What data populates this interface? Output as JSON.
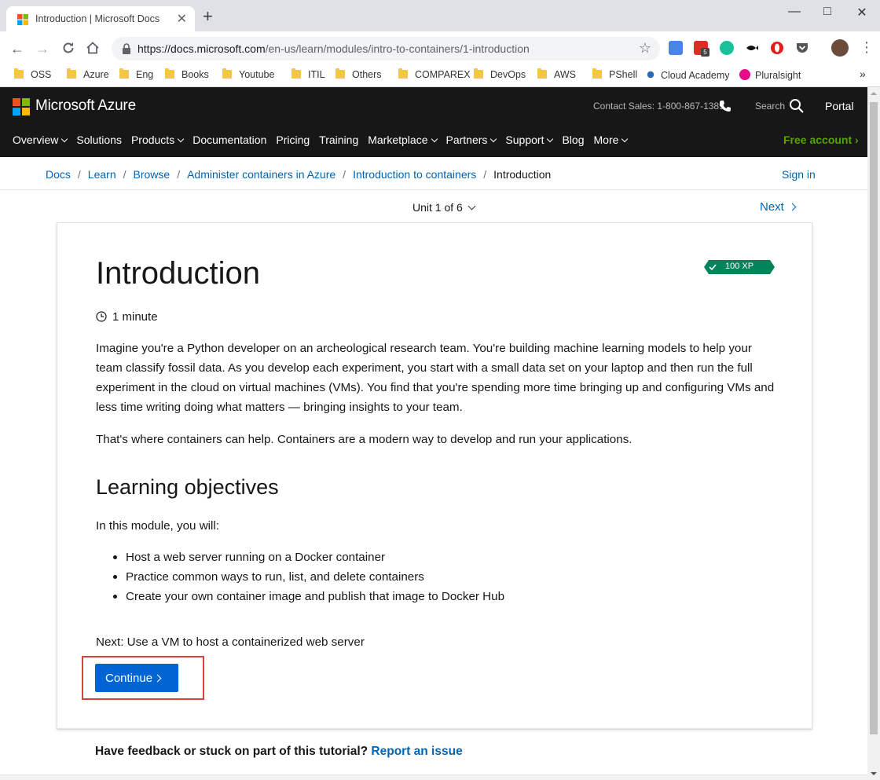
{
  "browser": {
    "tab_title": "Introduction | Microsoft Docs",
    "url_host": "https://docs.microsoft.com",
    "url_path": "/en-us/learn/modules/intro-to-containers/1-introduction",
    "extension_badge": "5",
    "bookmarks": [
      "OSS",
      "Azure",
      "Eng",
      "Books",
      "Youtube",
      "ITIL",
      "Others",
      "COMPAREX",
      "DevOps",
      "AWS",
      "PShell",
      "Cloud Academy",
      "Pluralsight"
    ],
    "bookmarks_more": "»"
  },
  "header": {
    "brand": "Microsoft Azure",
    "contact": "Contact Sales: 1-800-867-1389",
    "search_label": "Search",
    "portal": "Portal",
    "nav": [
      {
        "label": "Overview",
        "dropdown": true
      },
      {
        "label": "Solutions",
        "dropdown": false
      },
      {
        "label": "Products",
        "dropdown": true
      },
      {
        "label": "Documentation",
        "dropdown": false
      },
      {
        "label": "Pricing",
        "dropdown": false
      },
      {
        "label": "Training",
        "dropdown": false
      },
      {
        "label": "Marketplace",
        "dropdown": true
      },
      {
        "label": "Partners",
        "dropdown": true
      },
      {
        "label": "Support",
        "dropdown": true
      },
      {
        "label": "Blog",
        "dropdown": false
      },
      {
        "label": "More",
        "dropdown": true
      }
    ],
    "free_account": "Free account"
  },
  "breadcrumb": {
    "items": [
      "Docs",
      "Learn",
      "Browse",
      "Administer containers in Azure",
      "Introduction to containers"
    ],
    "current": "Introduction",
    "sign_in": "Sign in"
  },
  "unit_nav": {
    "unit_label": "Unit 1 of 6",
    "next_label": "Next"
  },
  "content": {
    "title": "Introduction",
    "xp": "100 XP",
    "duration": "1 minute",
    "paragraph1": "Imagine you're a Python developer on an archeological research team. You're building machine learning models to help your team classify fossil data. As you develop each experiment, you start with a small data set on your laptop and then run the full experiment in the cloud on virtual machines (VMs). You find that you're spending more time bringing up and configuring VMs and less time writing doing what matters — bringing insights to your team.",
    "paragraph2": "That's where containers can help. Containers are a modern way to develop and run your applications.",
    "objectives_heading": "Learning objectives",
    "objectives_intro": "In this module, you will:",
    "objectives": [
      "Host a web server running on a Docker container",
      "Practice common ways to run, list, and delete containers",
      "Create your own container image and publish that image to Docker Hub"
    ],
    "next_text": "Next: Use a VM to host a containerized web server",
    "continue_label": "Continue"
  },
  "feedback": {
    "question": "Have feedback or stuck on part of this tutorial?",
    "link": "Report an issue"
  },
  "colors": {
    "azure_header_bg": "#171717",
    "link": "#0065b3",
    "free_account": "#57a300",
    "continue_button": "#0065d3",
    "xp_badge": "#00845a",
    "highlight_box": "#d9413f"
  }
}
